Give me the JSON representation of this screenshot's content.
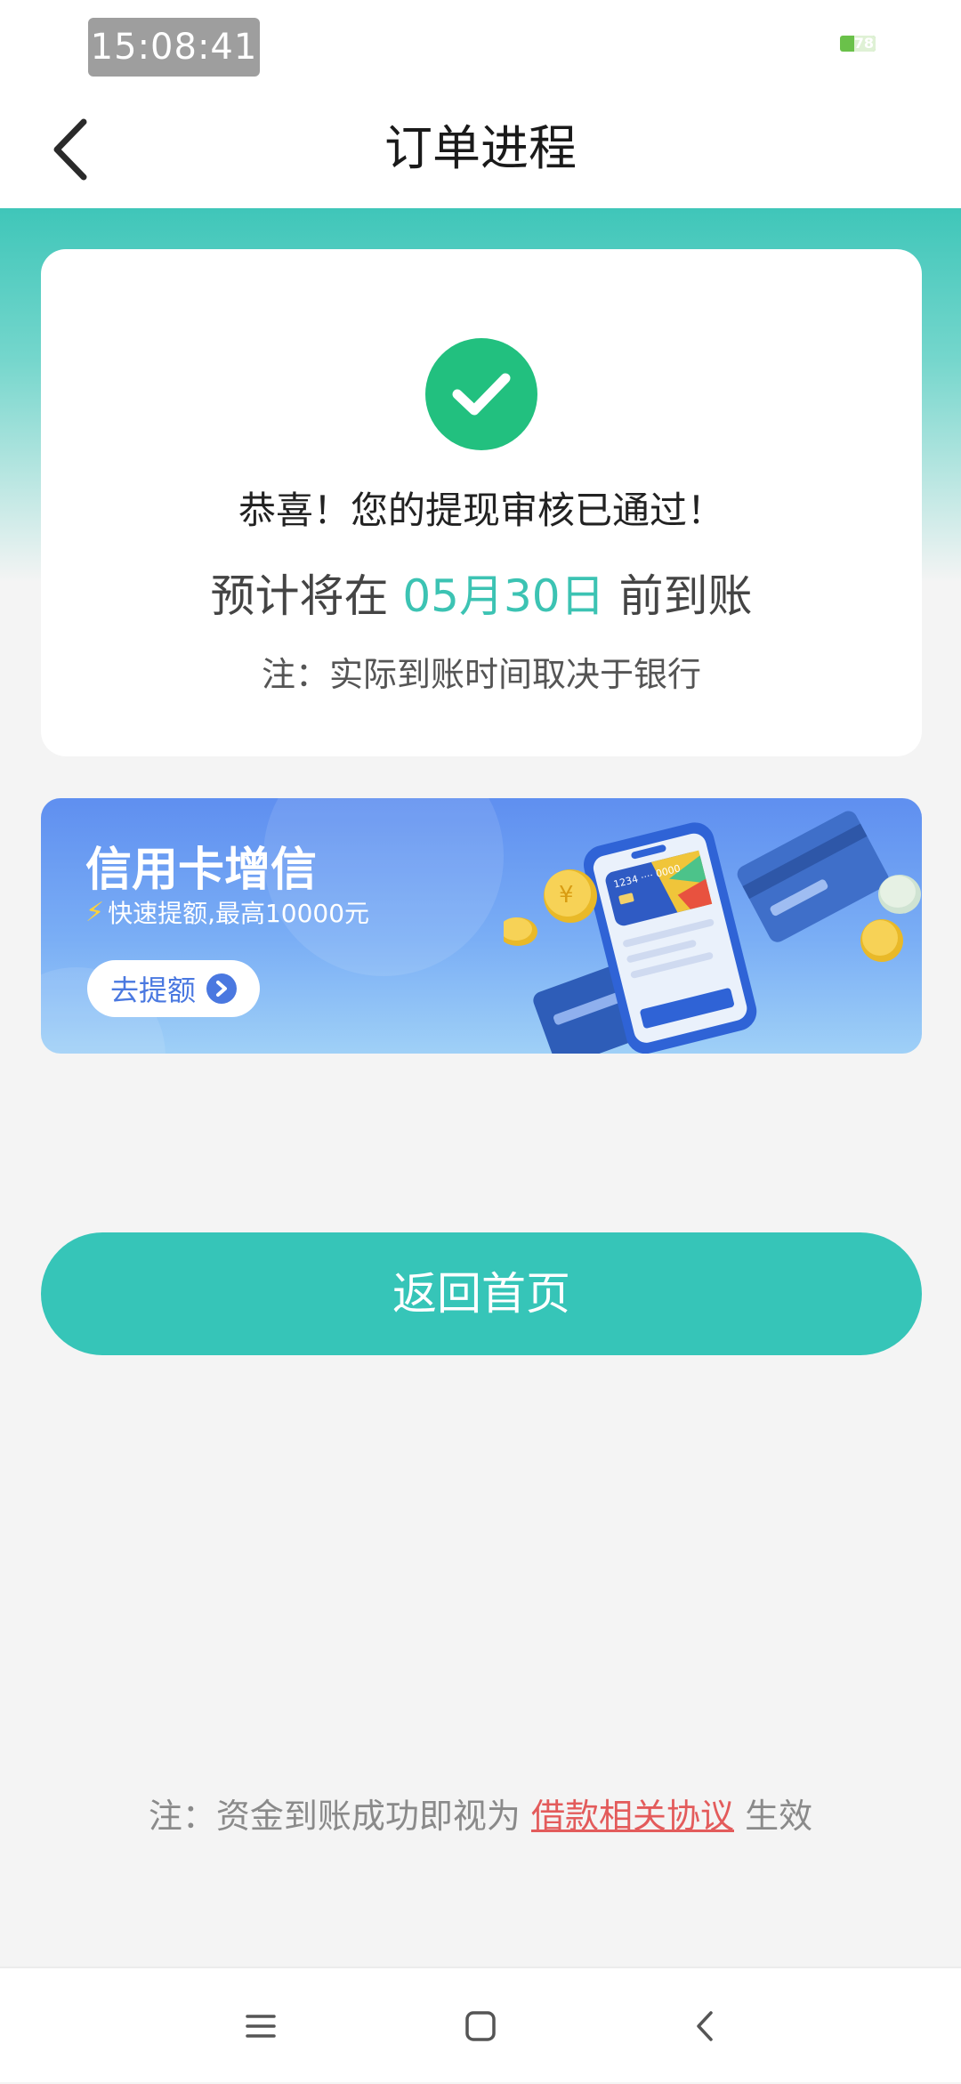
{
  "status_bar": {
    "time": "15:08:41",
    "battery": "78"
  },
  "header": {
    "title": "订单进程"
  },
  "result": {
    "congrats": "恭喜！您的提现审核已通过！",
    "expect_prefix": "预计将在",
    "expect_date": "05月30日",
    "expect_suffix": "前到账",
    "note": "注：实际到账时间取决于银行"
  },
  "banner": {
    "title": "信用卡增信",
    "subtitle": "快速提额,最高10000元",
    "button_label": "去提额",
    "card_number": "1234 ···· 0000"
  },
  "home_button": {
    "label": "返回首页"
  },
  "footer": {
    "note_prefix": "注：资金到账成功即视为",
    "agreement_link": "借款相关协议",
    "note_suffix": "生效"
  },
  "colors": {
    "accent": "#36c5b8",
    "success": "#22c07f",
    "link": "#e35b5b",
    "banner_blue": "#5f8ff0"
  },
  "icons": {
    "back": "chevron-left-icon",
    "success": "check-circle-icon",
    "nav_menu": "menu-icon",
    "nav_home": "square-home-icon",
    "nav_back": "back-triangle-icon"
  }
}
